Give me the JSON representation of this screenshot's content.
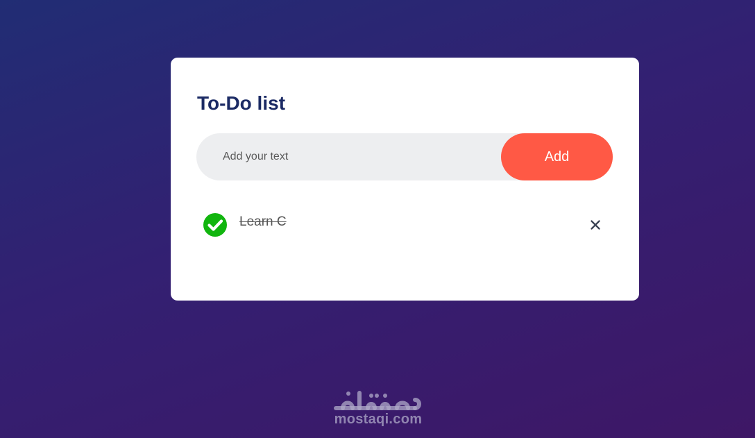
{
  "app": {
    "title": "To-Do list"
  },
  "input": {
    "value": "",
    "placeholder": "Add your text",
    "add_label": "Add"
  },
  "tasks": [
    {
      "label": "Learn C",
      "completed": true,
      "check_icon": "check-circle-icon",
      "delete_icon": "close-icon"
    }
  ],
  "watermark": {
    "logo_text": "مستقل",
    "url": "mostaqi.com"
  },
  "colors": {
    "background_start": "#212d74",
    "background_end": "#3e1766",
    "card": "#ffffff",
    "title": "#1b2a64",
    "input_background": "#edeef0",
    "accent": "#ff5945",
    "check": "#11b50e"
  }
}
